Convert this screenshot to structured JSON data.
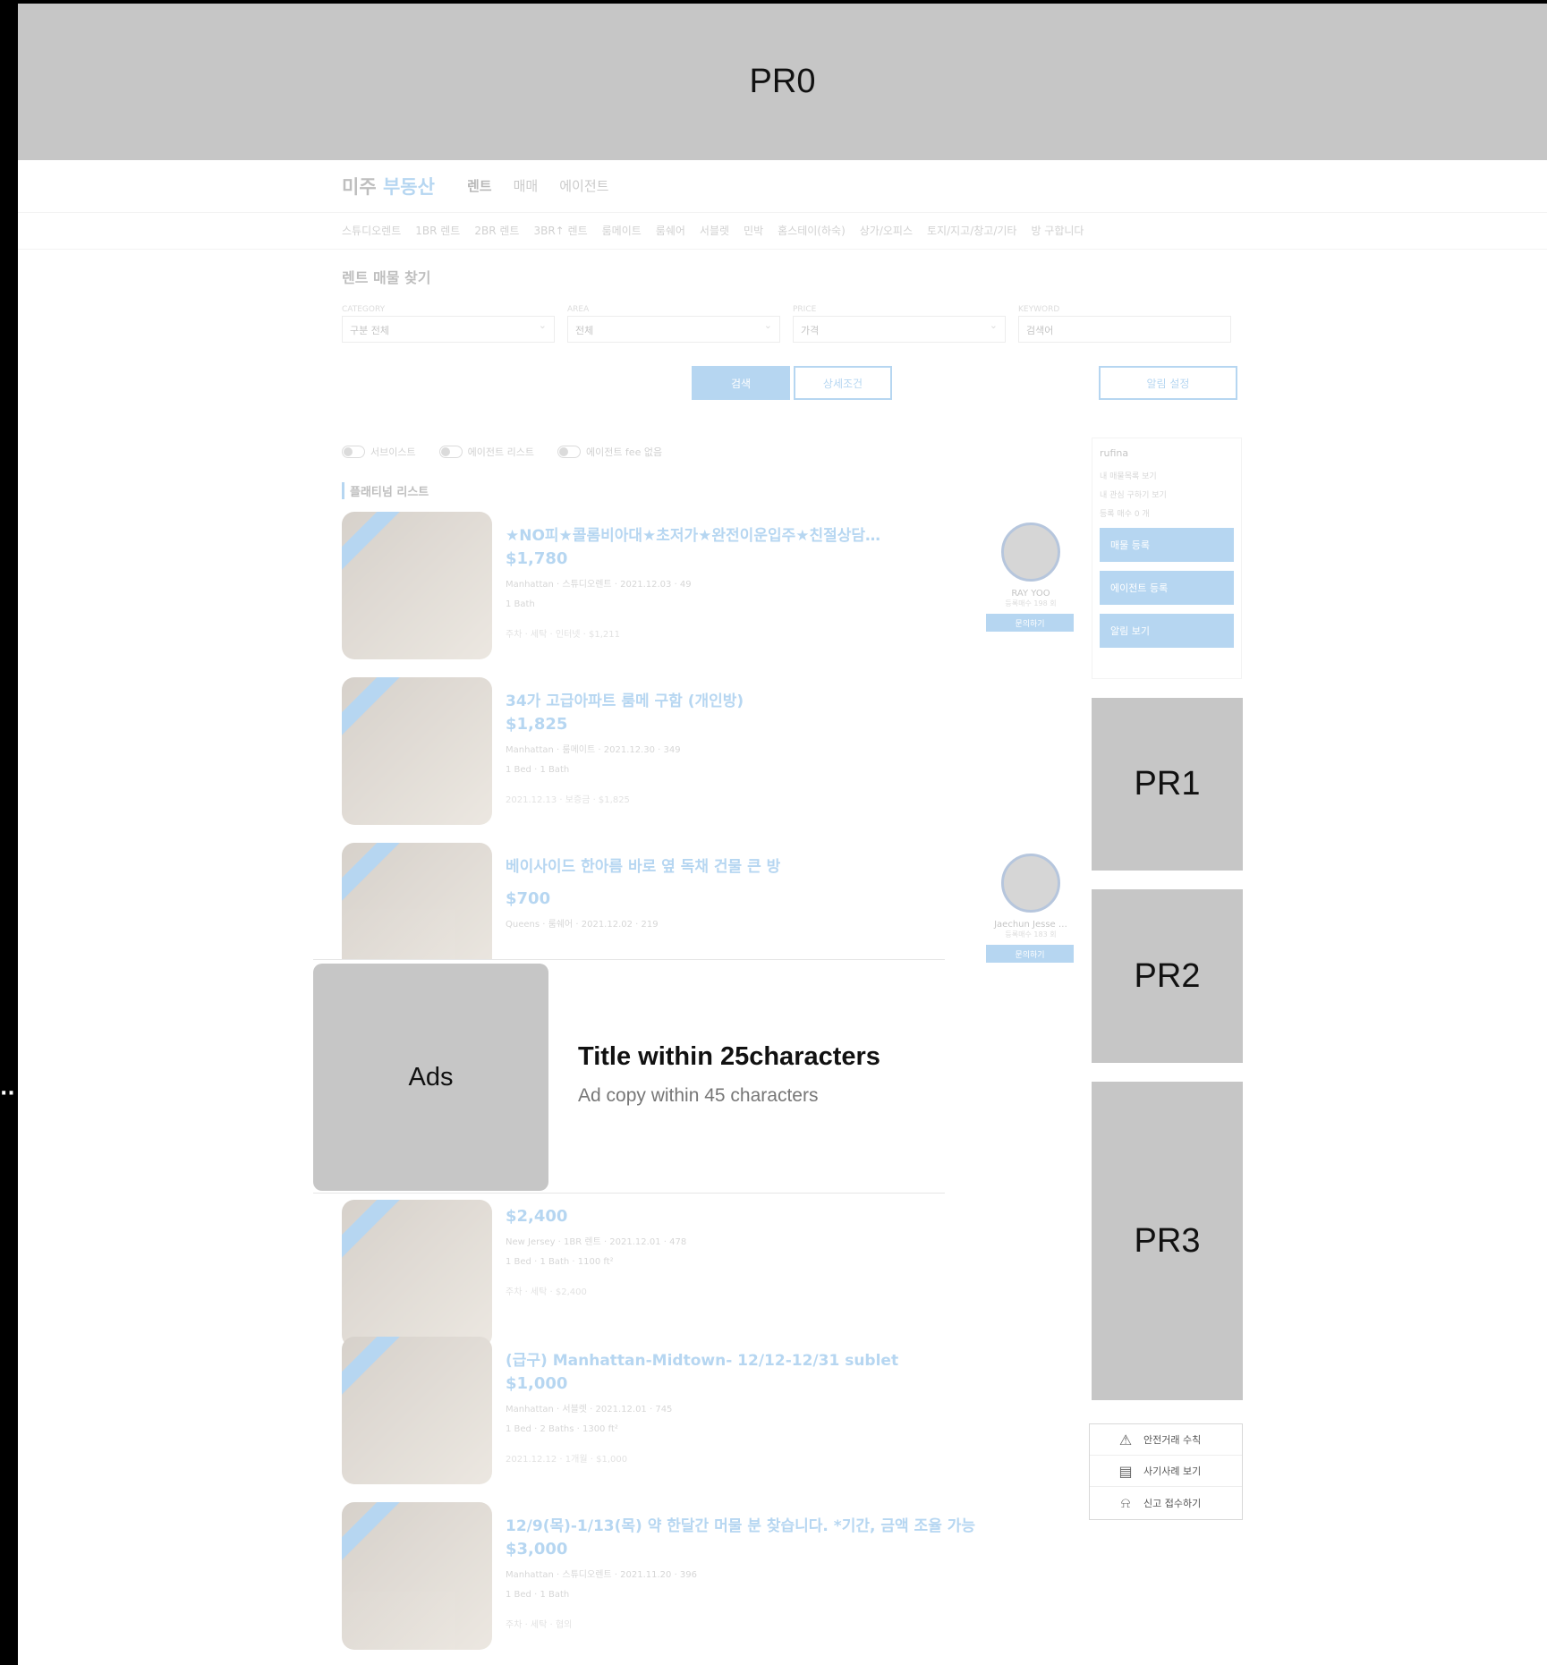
{
  "placeholders": {
    "pr0": "PR0",
    "pr1": "PR1",
    "pr2": "PR2",
    "pr3": "PR3"
  },
  "ad": {
    "image_label": "Ads",
    "title": "Title within 25characters",
    "copy": "Ad copy within 45 characters"
  },
  "site": {
    "logo_main": "미주",
    "logo_accent": "부동산",
    "nav": [
      "렌트",
      "매매",
      "에이전트"
    ],
    "categories": [
      "스튜디오렌트",
      "1BR 렌트",
      "2BR 렌트",
      "3BR↑ 렌트",
      "룸메이트",
      "룸쉐어",
      "서블렛",
      "민박",
      "홈스테이(하숙)",
      "상가/오피스",
      "토지/지고/창고/기타",
      "방 구합니다"
    ],
    "search_title": "렌트 매물 찾기",
    "filters": [
      {
        "label": "CATEGORY",
        "value": "구분 전체"
      },
      {
        "label": "AREA",
        "value": "전체"
      },
      {
        "label": "PRICE",
        "value": "가격"
      },
      {
        "label": "KEYWORD",
        "value": "검색어"
      }
    ],
    "search_btn": "검색",
    "detail_btn": "상세조건",
    "alarm_btn": "알림 설정",
    "toggles": [
      "서브이스트",
      "에이전트 리스트",
      "에이전트 fee 없음"
    ],
    "section_title": "플래티넘 리스트",
    "listings": [
      {
        "title": "★NO피★콜롬비아대★초저가★완전이운입주★친절상담…",
        "price": "$1,780",
        "meta": "Manhattan · 스튜디오렌트 · 2021.12.03 · 49",
        "rooms": "1 Bath",
        "extra": "주차 · 세탁 · 인터넷 · $1,211"
      },
      {
        "title": "34가 고급아파트 룸메 구함 (개인방)",
        "price": "$1,825",
        "meta": "Manhattan · 룸메이트 · 2021.12.30 · 349",
        "rooms": "1 Bed · 1 Bath",
        "extra": "2021.12.13 · 보증금 · $1,825"
      },
      {
        "title": "베이사이드 한아름 바로 옆 독채 건물 큰 방",
        "price": "$700",
        "meta": "Queens · 룸쉐어 · 2021.12.02 · 219",
        "rooms": "",
        "extra": ""
      },
      {
        "title": "",
        "price": "$2,400",
        "meta": "New Jersey · 1BR 렌트 · 2021.12.01 · 478",
        "rooms": "1 Bed · 1 Bath · 1100 ft²",
        "extra": "주차 · 세탁 · $2,400"
      },
      {
        "title": "(급구) Manhattan-Midtown- 12/12-12/31 sublet",
        "price": "$1,000",
        "meta": "Manhattan · 서블렛 · 2021.12.01 · 745",
        "rooms": "1 Bed · 2 Baths · 1300 ft²",
        "extra": "2021.12.12 · 1개월 · $1,000"
      },
      {
        "title": "12/9(목)-1/13(목) 약 한달간 머물 분 찾습니다. *기간, 금액 조율 가능",
        "price": "$3,000",
        "meta": "Manhattan · 스튜디오렌트 · 2021.11.20 · 396",
        "rooms": "1 Bed · 1 Bath",
        "extra": "주차 · 세탁 · 협의"
      }
    ],
    "agents": [
      {
        "name": "RAY YOO",
        "count": "등록매수 198 회",
        "contact": "문의하기"
      },
      {
        "name": "Jaechun Jesse …",
        "count": "등록매수 183 회",
        "contact": "문의하기"
      }
    ],
    "profile": {
      "user": "rufina",
      "lines": [
        "내 매물목록 보기",
        "내 관심 구하기 보기",
        "등록 매수 0 개"
      ],
      "buttons": [
        "매물 등록",
        "에이전트 등록",
        "알림 보기"
      ]
    },
    "notices": [
      "안전거래 수칙",
      "사기사례 보기",
      "신고 접수하기"
    ]
  },
  "ellipsis": "··"
}
